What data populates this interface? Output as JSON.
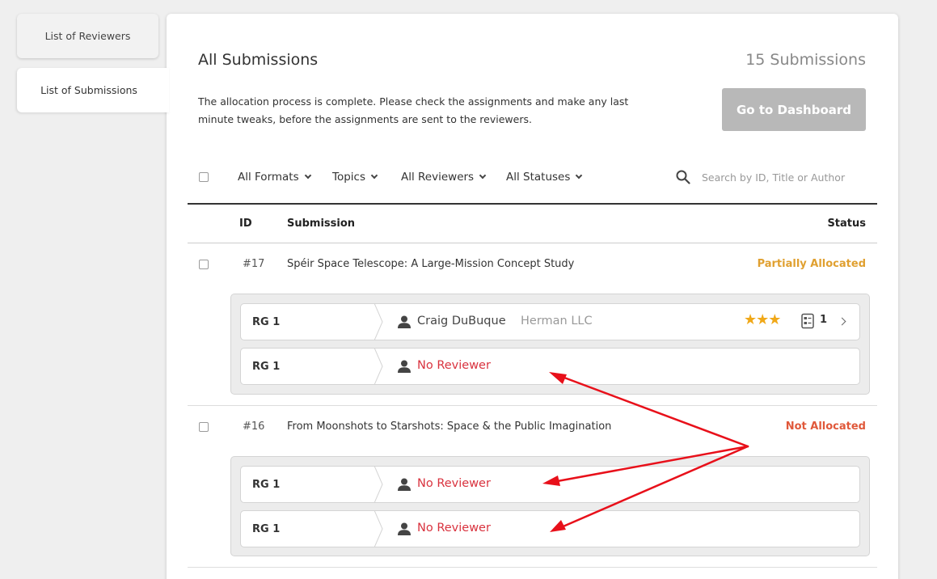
{
  "sidebar": {
    "tabs": [
      {
        "label": "List of Reviewers"
      },
      {
        "label": "List of Submissions"
      }
    ]
  },
  "header": {
    "title": "All Submissions",
    "count": "15 Submissions",
    "description": "The allocation process is complete. Please check the assignments and make any last minute tweaks, before the assignments are sent to the reviewers.",
    "dashboard_button": "Go to Dashboard"
  },
  "filters": {
    "formats": "All Formats",
    "topics": "Topics",
    "reviewers": "All Reviewers",
    "statuses": "All Statuses",
    "search_placeholder": "Search by ID, Title or Author"
  },
  "table": {
    "col_id": "ID",
    "col_submission": "Submission",
    "col_status": "Status"
  },
  "submissions": [
    {
      "id": "#17",
      "title": "Spéir Space Telescope: A Large-Mission Concept Study",
      "status": "Partially Allocated",
      "status_color": "#e0a030",
      "allocations": [
        {
          "group": "RG 1",
          "reviewer": "Craig DuBuque",
          "org": "Herman LLC",
          "stars": "★★★",
          "sheets": "1"
        },
        {
          "group": "RG 1",
          "reviewer": "No Reviewer"
        }
      ]
    },
    {
      "id": "#16",
      "title": "From Moonshots to Starshots: Space & the Public Imagination",
      "status": "Not Allocated",
      "status_color": "#e0583a",
      "allocations": [
        {
          "group": "RG 1",
          "reviewer": "No Reviewer"
        },
        {
          "group": "RG 1",
          "reviewer": "No Reviewer"
        }
      ]
    }
  ],
  "colors": {
    "no_reviewer": "#d9333f",
    "annotation_arrow": "#e8101a",
    "star": "#f0a818"
  }
}
